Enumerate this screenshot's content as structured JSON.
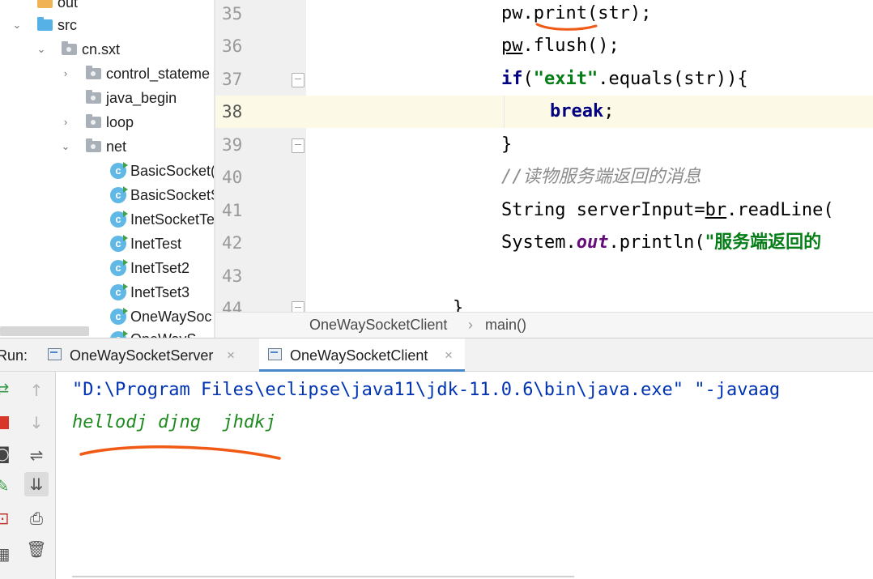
{
  "project_tree": {
    "items": [
      {
        "label": "out",
        "type": "folder-orange",
        "arrow": ""
      },
      {
        "label": "src",
        "type": "folder-blue",
        "arrow": "down"
      },
      {
        "label": "cn.sxt",
        "type": "package",
        "arrow": "down"
      },
      {
        "label": "control_stateme",
        "type": "package",
        "arrow": "right"
      },
      {
        "label": "java_begin",
        "type": "package",
        "arrow": ""
      },
      {
        "label": "loop",
        "type": "package",
        "arrow": "right"
      },
      {
        "label": "net",
        "type": "package",
        "arrow": "down"
      },
      {
        "label": "BasicSocket(",
        "type": "class",
        "arrow": ""
      },
      {
        "label": "BasicSocketS",
        "type": "class",
        "arrow": ""
      },
      {
        "label": "InetSocketTe",
        "type": "class",
        "arrow": ""
      },
      {
        "label": "InetTest",
        "type": "class",
        "arrow": ""
      },
      {
        "label": "InetTset2",
        "type": "class",
        "arrow": ""
      },
      {
        "label": "InetTset3",
        "type": "class",
        "arrow": ""
      },
      {
        "label": "OneWaySoc",
        "type": "class",
        "arrow": ""
      },
      {
        "label": "OneWayS",
        "type": "class",
        "arrow": ""
      }
    ]
  },
  "editor": {
    "line_numbers": [
      "35",
      "36",
      "37",
      "38",
      "39",
      "40",
      "41",
      "42",
      "43",
      "44"
    ],
    "code": {
      "l35_a": "pw.",
      "l35_b": "print",
      "l35_c": "(str);",
      "l36_a": "pw",
      "l36_b": ".flush();",
      "l37_kw": "if",
      "l37_a": "(",
      "l37_str": "\"exit\"",
      "l37_b": ".equals(str)){",
      "l38_kw": "break",
      "l38_a": ";",
      "l39": "}",
      "l40_slash": "//",
      "l40_cmt": "读物服务端返回的消息",
      "l41_a": "String serverInput=",
      "l41_b": "br",
      "l41_c": ".readLine(",
      "l42_a": "System.",
      "l42_field": "out",
      "l42_b": ".println(",
      "l42_str": "\"服务端返回的",
      "l44": "}"
    }
  },
  "breadcrumb": {
    "class_name": "OneWaySocketClient",
    "separator": "›",
    "method": "main()"
  },
  "run_panel": {
    "label": "Run:",
    "tabs": [
      {
        "label": "OneWaySocketServer",
        "close": "×"
      },
      {
        "label": "OneWaySocketClient",
        "close": "×"
      }
    ],
    "console_lines": [
      "\"D:\\Program Files\\eclipse\\java11\\jdk-11.0.6\\bin\\java.exe\" \"-javaag",
      "hellodj djng  jhdkj"
    ]
  },
  "colors": {
    "keyword": "#000080",
    "string": "#067d17",
    "comment": "#8c8c8c",
    "console_command": "#0033b3",
    "console_input": "#1f8a1f",
    "annotation_marker": "#f05a14",
    "current_line": "#fcfae6"
  }
}
